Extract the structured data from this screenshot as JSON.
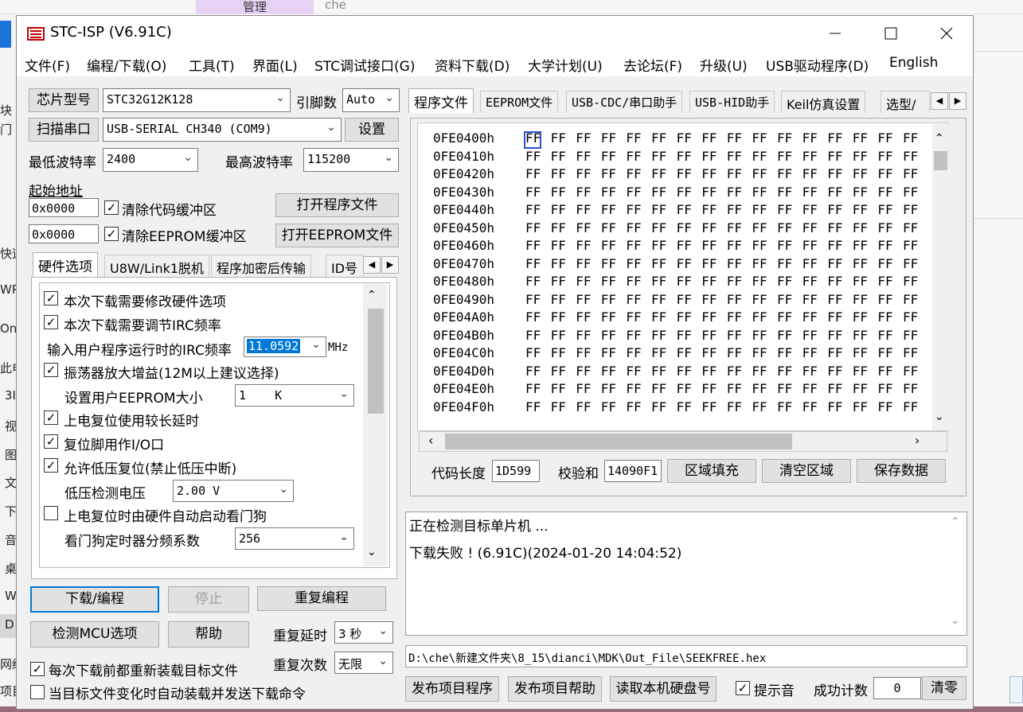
{
  "background": {
    "tab_label": "管理",
    "search_text": "che",
    "side_chars": [
      "块",
      "门",
      "快速",
      "WP",
      "On",
      "此电",
      "3I",
      "视",
      "图",
      "文",
      "下",
      "音",
      "桌",
      "W",
      "D",
      "网络",
      "项目"
    ]
  },
  "window": {
    "title": "STC-ISP (V6.91C)",
    "controls": {
      "minimize": "—",
      "maximize": "☐",
      "close": "✕"
    }
  },
  "menu": [
    "文件(F)",
    "编程/下载(O)",
    "工具(T)",
    "界面(L)",
    "STC调试接口(G)",
    "资料下载(D)",
    "大学计划(U)",
    "去论坛(F)",
    "升级(U)",
    "USB驱动程序(D)",
    "English"
  ],
  "left": {
    "chip_type_button": "芯片型号",
    "chip_type_value": "STC32G12K128",
    "pin_count_label": "引脚数",
    "pin_count_value": "Auto",
    "scan_port_button": "扫描串口",
    "port_value": "USB-SERIAL CH340 (COM9)",
    "settings_button": "设置",
    "min_baud_label": "最低波特率",
    "min_baud_value": "2400",
    "max_baud_label": "最高波特率",
    "max_baud_value": "115200",
    "start_addr_label": "起始地址",
    "code_addr_value": "0x0000",
    "clear_code_label": "清除代码缓冲区",
    "open_program_button": "打开程序文件",
    "eeprom_addr_value": "0x0000",
    "clear_eeprom_label": "清除EEPROM缓冲区",
    "open_eeprom_button": "打开EEPROM文件"
  },
  "left_tabs": [
    "硬件选项",
    "U8W/Link1脱机",
    "程序加密后传输",
    "ID号"
  ],
  "hw_options": {
    "opt1": "本次下载需要修改硬件选项",
    "opt2": "本次下载需要调节IRC频率",
    "irc_label": "输入用户程序运行时的IRC频率",
    "irc_value": "11.0592",
    "irc_unit": "MHz",
    "opt3": "振荡器放大增益(12M以上建议选择)",
    "eeprom_size_label": "设置用户EEPROM大小",
    "eeprom_size_value": "1    K",
    "opt4": "上电复位使用较长延时",
    "opt5": "复位脚用作I/O口",
    "opt6": "允许低压复位(禁止低压中断)",
    "lvd_label": "低压检测电压",
    "lvd_value": "2.00 V",
    "opt7": "上电复位时由硬件自动启动看门狗",
    "wdt_label": "看门狗定时器分频系数",
    "wdt_value": "256"
  },
  "bottom_left": {
    "download_button": "下载/编程",
    "stop_button": "停止",
    "reprogram_button": "重复编程",
    "check_mcu_button": "检测MCU选项",
    "help_button": "帮助",
    "repeat_delay_label": "重复延时",
    "repeat_delay_value": "3 秒",
    "repeat_count_label": "重复次数",
    "repeat_count_value": "无限",
    "reload_label": "每次下载前都重新装载目标文件",
    "auto_load_label": "当目标文件变化时自动装载并发送下载命令"
  },
  "right_tabs": [
    "程序文件",
    "EEPROM文件",
    "USB-CDC/串口助手",
    "USB-HID助手",
    "Keil仿真设置",
    "选型/"
  ],
  "hex": {
    "addresses": [
      "0FE0400h",
      "0FE0410h",
      "0FE0420h",
      "0FE0430h",
      "0FE0440h",
      "0FE0450h",
      "0FE0460h",
      "0FE0470h",
      "0FE0480h",
      "0FE0490h",
      "0FE04A0h",
      "0FE04B0h",
      "0FE04C0h",
      "0FE04D0h",
      "0FE04E0h",
      "0FE04F0h"
    ],
    "byte": "FF",
    "code_length_label": "代码长度",
    "code_length_value": "1D599",
    "checksum_label": "校验和",
    "checksum_value": "14090F1",
    "fill_button": "区域填充",
    "clear_button": "清空区域",
    "save_button": "保存数据"
  },
  "log": {
    "line1": "正在检测目标单片机 ...",
    "line2": "下载失败 ! (6.91C)(2024-01-20 14:04:52)"
  },
  "path": "D:\\che\\新建文件夹\\8_15\\dianci\\MDK\\Out_File\\SEEKFREE.hex",
  "bottom_right": {
    "publish_program_button": "发布项目程序",
    "publish_help_button": "发布项目帮助",
    "read_disk_button": "读取本机硬盘号",
    "sound_label": "提示音",
    "success_count_label": "成功计数",
    "success_count_value": "0",
    "clear_count_button": "清零"
  },
  "colors": {
    "accent": "#0078d7",
    "selection": "#0078d7",
    "hex_cursor": "#2b50d8"
  }
}
